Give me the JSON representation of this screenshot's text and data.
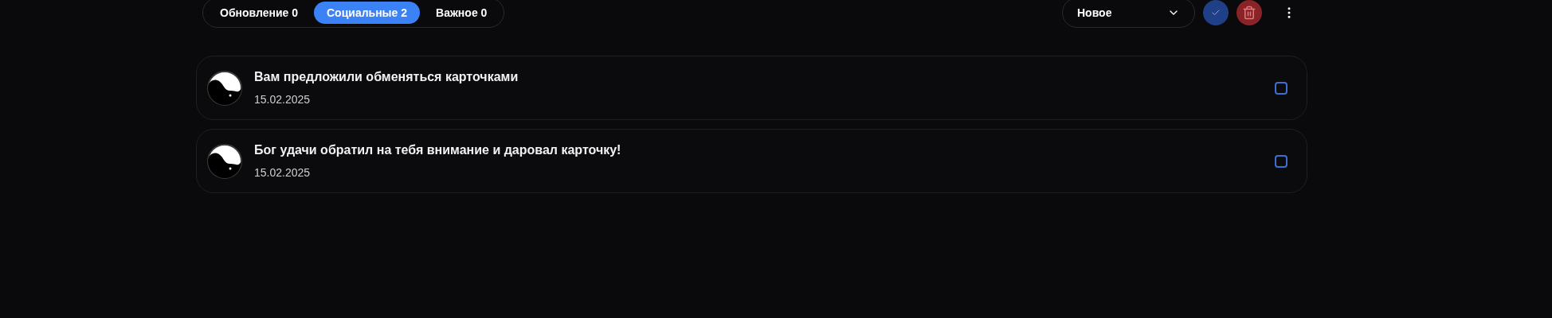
{
  "tabs": [
    {
      "label": "Обновление 0",
      "selected": false
    },
    {
      "label": "Социальные 2",
      "selected": true
    },
    {
      "label": "Важное 0",
      "selected": false
    }
  ],
  "sort": {
    "value": "Новое"
  },
  "notifications": [
    {
      "title": "Вам предложили обменяться карточками",
      "date": "15.02.2025",
      "checked": false
    },
    {
      "title": "Бог удачи обратил на тебя внимание и даровал карточку!",
      "date": "15.02.2025",
      "checked": false
    }
  ]
}
